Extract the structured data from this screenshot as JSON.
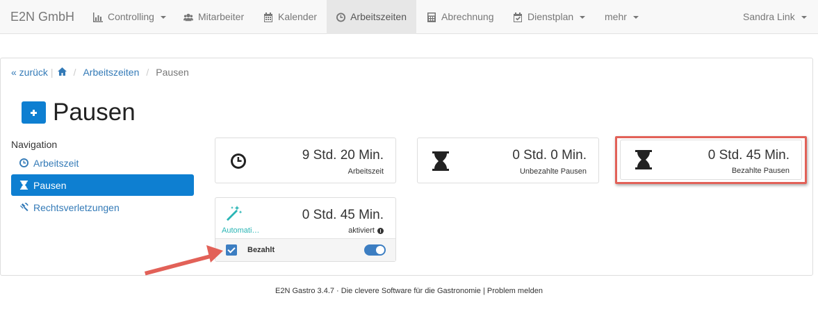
{
  "navbar": {
    "brand": "E2N GmbH",
    "items": [
      {
        "label": "Controlling",
        "icon": "bar-chart-icon"
      },
      {
        "label": "Mitarbeiter",
        "icon": "users-icon"
      },
      {
        "label": "Kalender",
        "icon": "calendar-icon"
      },
      {
        "label": "Arbeitszeiten",
        "icon": "clock-icon"
      },
      {
        "label": "Abrechnung",
        "icon": "calculator-icon"
      },
      {
        "label": "Dienstplan",
        "icon": "calendar-check-icon"
      },
      {
        "label": "mehr"
      }
    ],
    "user": "Sandra Link"
  },
  "breadcrumb": {
    "back": "« zurück",
    "link": "Arbeitszeiten",
    "current": "Pausen"
  },
  "page": {
    "title": "Pausen"
  },
  "sidebar": {
    "heading": "Navigation",
    "items": [
      {
        "label": "Arbeitszeit",
        "icon": "clock-icon"
      },
      {
        "label": "Pausen",
        "icon": "hourglass-icon"
      },
      {
        "label": "Rechtsverletzungen",
        "icon": "gavel-icon"
      }
    ]
  },
  "cards": {
    "arbeitszeit": {
      "value": "9 Std. 20 Min.",
      "label": "Arbeitszeit"
    },
    "unbezahlt": {
      "value": "0 Std. 0 Min.",
      "label": "Unbezahlte Pausen"
    },
    "bezahlt": {
      "value": "0 Std. 45 Min.",
      "label": "Bezahlte Pausen"
    },
    "automatic": {
      "value": "0 Std. 45 Min.",
      "name": "Automati…",
      "status": "aktiviert",
      "footer_label": "Bezahlt"
    }
  },
  "footer": {
    "text": "E2N Gastro 3.4.7 · Die clevere Software für die Gastronomie | Problem melden"
  },
  "colors": {
    "accent": "#0e7fd1",
    "link": "#337ab7",
    "highlight": "#e26158",
    "magic": "#2ab5b5"
  }
}
